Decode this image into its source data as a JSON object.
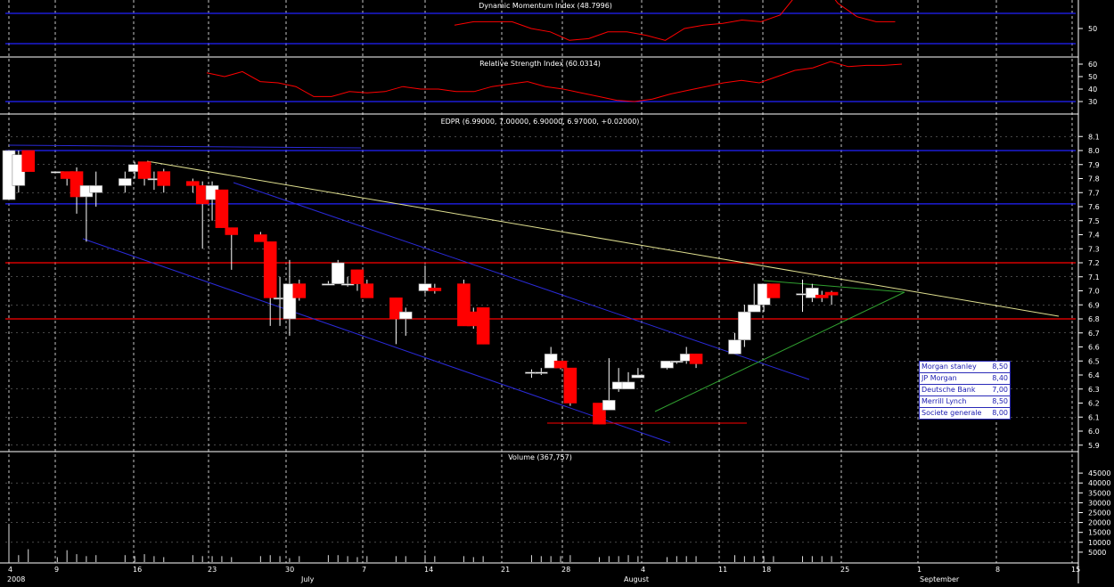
{
  "panels": {
    "dmi": {
      "title": "Dynamic Momentum Index (48.7996)",
      "ticks": [
        50
      ]
    },
    "rsi": {
      "title": "Relative Strength Index (60.0314)",
      "ticks": [
        60,
        50,
        40,
        30
      ]
    },
    "price": {
      "title": "EDPR (6.99000, 7.00000, 6.90000, 6.97000, +0.02000)",
      "ticks": [
        "8.1",
        "8.0",
        "7.9",
        "7.8",
        "7.7",
        "7.6",
        "7.5",
        "7.4",
        "7.3",
        "7.2",
        "7.1",
        "7.0",
        "6.9",
        "6.8",
        "6.7",
        "6.6",
        "6.5",
        "6.4",
        "6.3",
        "6.2",
        "6.1",
        "6.0",
        "5.9"
      ]
    },
    "volume": {
      "title": "Volume (367,757)",
      "ticks": [
        "45000",
        "40000",
        "35000",
        "30000",
        "25000",
        "20000",
        "15000",
        "10000",
        "5000"
      ]
    }
  },
  "x_axis": {
    "day_labels": [
      "4",
      "9",
      "16",
      "23",
      "30",
      "7",
      "14",
      "21",
      "28",
      "4",
      "11",
      "18",
      "25",
      "1",
      "8",
      "15"
    ],
    "month_labels": [
      "2008",
      "July",
      "August",
      "September"
    ]
  },
  "legend": [
    {
      "name": "Morgan stanley",
      "value": "8,50"
    },
    {
      "name": "JP Morgan",
      "value": "8,40"
    },
    {
      "name": "Deutsche Bank",
      "value": "7,00"
    },
    {
      "name": "Merrill Lynch",
      "value": "8,50"
    },
    {
      "name": "Societe generale",
      "value": "8,00"
    }
  ],
  "colors": {
    "background": "#000000",
    "grid": "#ffffff",
    "up_candle": "#ffffff",
    "down_candle": "#ff0000",
    "dmi_line": "#ff0000",
    "rsi_line": "#ff0000",
    "hband": "#2222ff",
    "resistance": "#ff0000",
    "trend_yellow": "#e0e090",
    "channel_blue": "#2a2ad8",
    "trend_green": "#30a030"
  },
  "chart_data": [
    {
      "type": "candlestick",
      "title": "EDPR (6.99000, 7.00000, 6.90000, 6.97000, +0.02000)",
      "ylim": [
        5.85,
        8.15
      ],
      "grid": true,
      "horizontal_levels": {
        "blue": [
          8.0,
          7.62
        ],
        "red": [
          7.2,
          6.8
        ]
      },
      "ohlc": [
        {
          "date": "2008-06-04",
          "o": 7.65,
          "h": 8.0,
          "l": 7.65,
          "c": 8.0
        },
        {
          "date": "2008-06-05",
          "o": 7.75,
          "h": 8.0,
          "l": 7.7,
          "c": 7.97
        },
        {
          "date": "2008-06-06",
          "o": 8.0,
          "h": 8.0,
          "l": 7.85,
          "c": 7.85
        },
        {
          "date": "2008-06-09",
          "o": 7.85,
          "h": 7.85,
          "l": 7.85,
          "c": 7.85
        },
        {
          "date": "2008-06-10",
          "o": 7.85,
          "h": 7.85,
          "l": 7.75,
          "c": 7.8
        },
        {
          "date": "2008-06-11",
          "o": 7.85,
          "h": 7.88,
          "l": 7.55,
          "c": 7.67
        },
        {
          "date": "2008-06-12",
          "o": 7.67,
          "h": 7.75,
          "l": 7.35,
          "c": 7.75
        },
        {
          "date": "2008-06-13",
          "o": 7.7,
          "h": 7.85,
          "l": 7.6,
          "c": 7.75
        },
        {
          "date": "2008-06-16",
          "o": 7.75,
          "h": 7.85,
          "l": 7.7,
          "c": 7.8
        },
        {
          "date": "2008-06-17",
          "o": 7.85,
          "h": 7.92,
          "l": 7.8,
          "c": 7.9
        },
        {
          "date": "2008-06-18",
          "o": 7.92,
          "h": 7.92,
          "l": 7.75,
          "c": 7.8
        },
        {
          "date": "2008-06-19",
          "o": 7.8,
          "h": 7.85,
          "l": 7.72,
          "c": 7.8
        },
        {
          "date": "2008-06-20",
          "o": 7.85,
          "h": 7.87,
          "l": 7.7,
          "c": 7.75
        },
        {
          "date": "2008-06-23",
          "o": 7.78,
          "h": 7.8,
          "l": 7.7,
          "c": 7.75
        },
        {
          "date": "2008-06-24",
          "o": 7.75,
          "h": 7.78,
          "l": 7.3,
          "c": 7.62
        },
        {
          "date": "2008-06-25",
          "o": 7.65,
          "h": 7.78,
          "l": 7.5,
          "c": 7.75
        },
        {
          "date": "2008-06-26",
          "o": 7.72,
          "h": 7.72,
          "l": 7.45,
          "c": 7.45
        },
        {
          "date": "2008-06-27",
          "o": 7.45,
          "h": 7.45,
          "l": 7.15,
          "c": 7.4
        },
        {
          "date": "2008-06-30",
          "o": 7.4,
          "h": 7.42,
          "l": 7.35,
          "c": 7.35
        },
        {
          "date": "2008-07-01",
          "o": 7.35,
          "h": 7.35,
          "l": 6.75,
          "c": 6.95
        },
        {
          "date": "2008-07-02",
          "o": 6.95,
          "h": 7.1,
          "l": 6.75,
          "c": 6.95
        },
        {
          "date": "2008-07-03",
          "o": 6.8,
          "h": 7.22,
          "l": 6.68,
          "c": 7.05
        },
        {
          "date": "2008-07-04",
          "o": 7.05,
          "h": 7.08,
          "l": 6.93,
          "c": 6.95
        },
        {
          "date": "2008-07-07",
          "o": 7.05,
          "h": 7.07,
          "l": 7.05,
          "c": 7.05
        },
        {
          "date": "2008-07-08",
          "o": 7.05,
          "h": 7.22,
          "l": 7.05,
          "c": 7.2
        },
        {
          "date": "2008-07-09",
          "o": 7.05,
          "h": 7.1,
          "l": 7.03,
          "c": 7.05
        },
        {
          "date": "2008-07-10",
          "o": 7.15,
          "h": 7.15,
          "l": 7.0,
          "c": 7.05
        },
        {
          "date": "2008-07-11",
          "o": 7.05,
          "h": 7.08,
          "l": 6.95,
          "c": 6.95
        },
        {
          "date": "2008-07-14",
          "o": 6.95,
          "h": 6.95,
          "l": 6.62,
          "c": 6.8
        },
        {
          "date": "2008-07-15",
          "o": 6.8,
          "h": 6.88,
          "l": 6.68,
          "c": 6.85
        },
        {
          "date": "2008-07-17",
          "o": 7.0,
          "h": 7.18,
          "l": 6.98,
          "c": 7.05
        },
        {
          "date": "2008-07-18",
          "o": 7.02,
          "h": 7.05,
          "l": 6.98,
          "c": 7.0
        },
        {
          "date": "2008-07-21",
          "o": 7.05,
          "h": 7.08,
          "l": 6.75,
          "c": 6.75
        },
        {
          "date": "2008-07-22",
          "o": 6.85,
          "h": 6.88,
          "l": 6.73,
          "c": 6.75
        },
        {
          "date": "2008-07-23",
          "o": 6.88,
          "h": 6.88,
          "l": 6.62,
          "c": 6.62
        },
        {
          "date": "2008-07-28",
          "o": 6.42,
          "h": 6.44,
          "l": 6.38,
          "c": 6.42
        },
        {
          "date": "2008-07-29",
          "o": 6.42,
          "h": 6.45,
          "l": 6.4,
          "c": 6.42
        },
        {
          "date": "2008-07-30",
          "o": 6.45,
          "h": 6.6,
          "l": 6.45,
          "c": 6.55
        },
        {
          "date": "2008-07-31",
          "o": 6.5,
          "h": 6.5,
          "l": 6.44,
          "c": 6.45
        },
        {
          "date": "2008-08-01",
          "o": 6.45,
          "h": 6.45,
          "l": 6.18,
          "c": 6.2
        },
        {
          "date": "2008-08-04",
          "o": 6.2,
          "h": 6.2,
          "l": 6.05,
          "c": 6.05
        },
        {
          "date": "2008-08-05",
          "o": 6.15,
          "h": 6.52,
          "l": 6.15,
          "c": 6.22
        },
        {
          "date": "2008-08-06",
          "o": 6.3,
          "h": 6.45,
          "l": 6.28,
          "c": 6.35
        },
        {
          "date": "2008-08-07",
          "o": 6.3,
          "h": 6.42,
          "l": 6.3,
          "c": 6.35
        },
        {
          "date": "2008-08-08",
          "o": 6.38,
          "h": 6.45,
          "l": 6.38,
          "c": 6.4
        },
        {
          "date": "2008-08-11",
          "o": 6.45,
          "h": 6.5,
          "l": 6.44,
          "c": 6.5
        },
        {
          "date": "2008-08-12",
          "o": 6.5,
          "h": 6.5,
          "l": 6.48,
          "c": 6.5
        },
        {
          "date": "2008-08-13",
          "o": 6.5,
          "h": 6.6,
          "l": 6.48,
          "c": 6.55
        },
        {
          "date": "2008-08-14",
          "o": 6.55,
          "h": 6.55,
          "l": 6.45,
          "c": 6.48
        },
        {
          "date": "2008-08-18",
          "o": 6.55,
          "h": 6.7,
          "l": 6.55,
          "c": 6.65
        },
        {
          "date": "2008-08-19",
          "o": 6.65,
          "h": 6.9,
          "l": 6.6,
          "c": 6.85
        },
        {
          "date": "2008-08-20",
          "o": 6.85,
          "h": 7.05,
          "l": 6.85,
          "c": 6.9
        },
        {
          "date": "2008-08-21",
          "o": 6.9,
          "h": 7.05,
          "l": 6.85,
          "c": 7.05
        },
        {
          "date": "2008-08-22",
          "o": 7.05,
          "h": 7.05,
          "l": 6.95,
          "c": 6.95
        },
        {
          "date": "2008-08-25",
          "o": 6.98,
          "h": 7.08,
          "l": 6.85,
          "c": 6.98
        },
        {
          "date": "2008-08-26",
          "o": 6.95,
          "h": 7.05,
          "l": 6.92,
          "c": 7.02
        },
        {
          "date": "2008-08-27",
          "o": 6.97,
          "h": 7.0,
          "l": 6.92,
          "c": 6.95
        },
        {
          "date": "2008-08-28",
          "o": 6.99,
          "h": 7.0,
          "l": 6.9,
          "c": 6.97
        }
      ]
    },
    {
      "type": "line",
      "title": "Dynamic Momentum Index (48.7996)",
      "ylim": [
        47,
        53
      ],
      "series": [
        {
          "values": [
            50.2,
            50.4,
            50.4,
            50.4,
            50.0,
            49.8,
            49.3,
            49.4,
            49.8,
            49.8,
            49.6,
            49.3,
            50.0,
            50.2,
            50.3,
            50.5,
            50.4,
            50.8,
            52.2,
            53.0,
            51.5,
            50.7,
            50.4,
            50.4
          ]
        }
      ]
    },
    {
      "type": "line",
      "title": "Relative Strength Index (60.0314)",
      "ylim": [
        25,
        65
      ],
      "series": [
        {
          "values": [
            53,
            50,
            54,
            46,
            45,
            42,
            34,
            34,
            38,
            37,
            38,
            42,
            40,
            40,
            38,
            38,
            42,
            44,
            46,
            42,
            40,
            37,
            34,
            31,
            30,
            32,
            36,
            39,
            42,
            45,
            47,
            45,
            50,
            55,
            57,
            62,
            58,
            59,
            59,
            60
          ]
        }
      ]
    },
    {
      "type": "bar",
      "title": "Volume (367,757)",
      "ylim": [
        0,
        50000
      ],
      "values": [
        19000,
        3500,
        6500,
        2500,
        6000,
        4000,
        3000,
        3500,
        3500,
        3000,
        4000,
        3000,
        2500,
        3500,
        3000,
        3000,
        3000,
        2500,
        3000,
        3500,
        3000,
        2000,
        3000,
        3500,
        3500,
        3000,
        2500,
        3000,
        3000,
        3000,
        3500,
        3000,
        3000,
        2500,
        3000,
        3500,
        3000,
        3000,
        3000,
        3500,
        2500,
        3000,
        3000,
        3500,
        3000,
        2500,
        3000,
        3000,
        3000,
        3500,
        3000,
        3000,
        3000,
        3000,
        3000,
        3000,
        3000,
        3000
      ]
    }
  ]
}
